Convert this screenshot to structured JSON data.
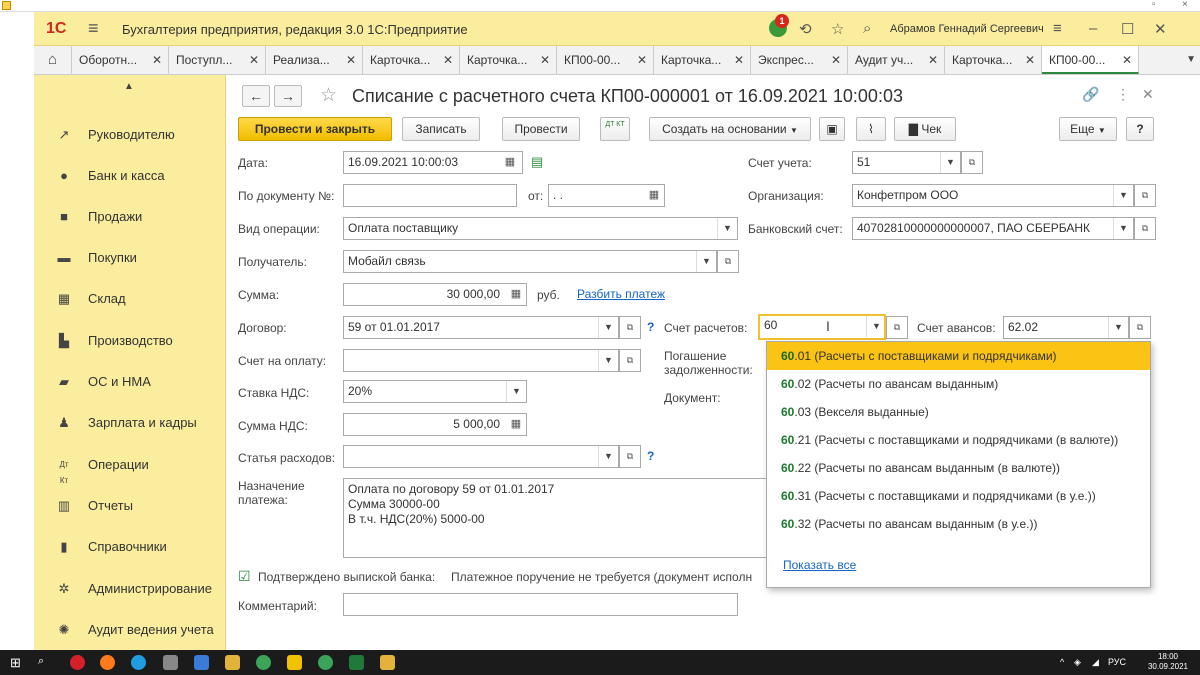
{
  "app": {
    "title": "Бухгалтерия предприятия, редакция 3.0 1С:Предприятие",
    "logo_text": "1С",
    "user": "Абрамов Геннадий Сергеевич",
    "notification_count": "1"
  },
  "tabs": [
    {
      "label": "Оборотн..."
    },
    {
      "label": "Поступл..."
    },
    {
      "label": "Реализа..."
    },
    {
      "label": "Карточка..."
    },
    {
      "label": "Карточка..."
    },
    {
      "label": "КП00-00..."
    },
    {
      "label": "Карточка..."
    },
    {
      "label": "Экспрес..."
    },
    {
      "label": "Аудит уч..."
    },
    {
      "label": "Карточка..."
    },
    {
      "label": "КП00-00..."
    }
  ],
  "sidebar": {
    "items": [
      {
        "label": "Руководителю",
        "icon": "chart-trend-icon"
      },
      {
        "label": "Банк и касса",
        "icon": "coin-icon"
      },
      {
        "label": "Продажи",
        "icon": "shopping-bag-icon"
      },
      {
        "label": "Покупки",
        "icon": "cart-icon"
      },
      {
        "label": "Склад",
        "icon": "warehouse-icon"
      },
      {
        "label": "Производство",
        "icon": "factory-icon"
      },
      {
        "label": "ОС и НМА",
        "icon": "truck-icon"
      },
      {
        "label": "Зарплата и кадры",
        "icon": "person-icon"
      },
      {
        "label": "Операции",
        "icon": "dt-kt-icon"
      },
      {
        "label": "Отчеты",
        "icon": "bar-chart-icon"
      },
      {
        "label": "Справочники",
        "icon": "book-icon"
      },
      {
        "label": "Администрирование",
        "icon": "gear-icon"
      },
      {
        "label": "Аудит ведения учета",
        "icon": "audit-icon"
      }
    ]
  },
  "document": {
    "title": "Списание с расчетного счета КП00-000001 от 16.09.2021 10:00:03"
  },
  "toolbar": {
    "post_close": "Провести и закрыть",
    "save": "Записать",
    "post": "Провести",
    "dtkt": "ДТ КТ",
    "create_basis": "Создать на основании",
    "check": "Чек",
    "more": "Еще",
    "help": "?"
  },
  "form": {
    "date_label": "Дата:",
    "date_value": "16.09.2021 10:00:03",
    "docnum_label": "По документу №:",
    "docnum_value": "",
    "from_label": "от:",
    "from_value": " .  .",
    "optype_label": "Вид операции:",
    "optype_value": "Оплата поставщику",
    "recipient_label": "Получатель:",
    "recipient_value": "Мобайл связь",
    "sum_label": "Сумма:",
    "sum_value": "30 000,00",
    "currency": "руб.",
    "split_link": "Разбить платеж",
    "contract_label": "Договор:",
    "contract_value": "59 от 01.01.2017",
    "invoice_label": "Счет на оплату:",
    "invoice_value": "",
    "vat_rate_label": "Ставка НДС:",
    "vat_rate_value": "20%",
    "vat_sum_label": "Сумма НДС:",
    "vat_sum_value": "5 000,00",
    "expense_label": "Статья расходов:",
    "expense_value": "",
    "purpose_label_1": "Назначение",
    "purpose_label_2": "платежа:",
    "purpose_lines": [
      "Оплата по договору 59 от 01.01.2017",
      "Сумма 30000-00",
      "В т.ч. НДС(20%) 5000-00"
    ],
    "confirmed_label": "Подтверждено выпиской банка:",
    "payment_order_text": "Платежное поручение не требуется (документ исполн",
    "comment_label": "Комментарий:",
    "comment_value": "",
    "account_label": "Счет учета:",
    "account_value": "51",
    "org_label": "Организация:",
    "org_value": "Конфетпром ООО",
    "bank_label": "Банковский счет:",
    "bank_value": "40702810000000000007, ПАО СБЕРБАНК",
    "settle_label": "Счет расчетов:",
    "settle_value": "60",
    "advance_label": "Счет авансов:",
    "advance_value": "62.02",
    "repay_label_1": "Погашение",
    "repay_label_2": "задолженности:",
    "doc_label": "Документ:"
  },
  "dropdown": {
    "items": [
      {
        "code": "60",
        "rest": ".01 (Расчеты с поставщиками и подрядчиками)"
      },
      {
        "code": "60",
        "rest": ".02 (Расчеты по авансам выданным)"
      },
      {
        "code": "60",
        "rest": ".03 (Векселя выданные)"
      },
      {
        "code": "60",
        "rest": ".21 (Расчеты с поставщиками и подрядчиками (в валюте))"
      },
      {
        "code": "60",
        "rest": ".22 (Расчеты по авансам выданным (в валюте))"
      },
      {
        "code": "60",
        "rest": ".31 (Расчеты с поставщиками и подрядчиками (в у.е.))"
      },
      {
        "code": "60",
        "rest": ".32 (Расчеты по авансам выданным (в у.е.))"
      }
    ],
    "show_all": "Показать все"
  },
  "taskbar": {
    "lang": "РУС",
    "time": "18:00",
    "date": "30.09.2021"
  }
}
